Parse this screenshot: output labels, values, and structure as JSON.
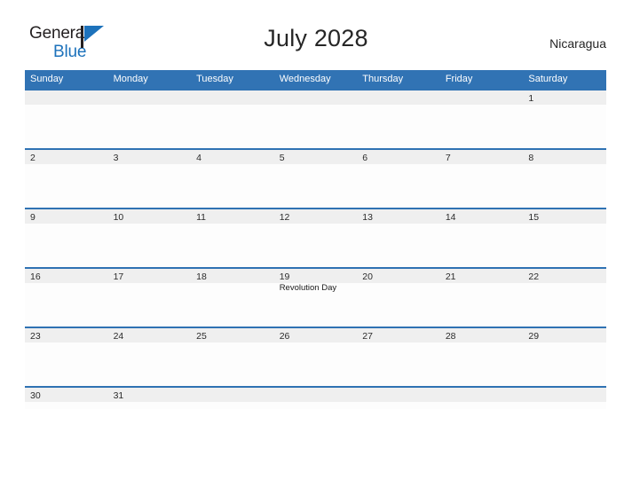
{
  "logo": {
    "word_one": "General",
    "word_two": "Blue",
    "flag_icon": "blue-flag-triangle-icon",
    "accent_color": "#1d72bb"
  },
  "header": {
    "title": "July 2028",
    "country": "Nicaragua"
  },
  "theme": {
    "header_blue": "#3173b4",
    "divider_blue": "#2f72b3",
    "daynum_band": "#efefef",
    "cell_background": "#fdfdfd",
    "text_dark": "#262626"
  },
  "calendar": {
    "weekday_headers": [
      "Sunday",
      "Monday",
      "Tuesday",
      "Wednesday",
      "Thursday",
      "Friday",
      "Saturday"
    ],
    "weeks": [
      [
        {
          "day": "",
          "events": []
        },
        {
          "day": "",
          "events": []
        },
        {
          "day": "",
          "events": []
        },
        {
          "day": "",
          "events": []
        },
        {
          "day": "",
          "events": []
        },
        {
          "day": "",
          "events": []
        },
        {
          "day": "1",
          "events": []
        }
      ],
      [
        {
          "day": "2",
          "events": []
        },
        {
          "day": "3",
          "events": []
        },
        {
          "day": "4",
          "events": []
        },
        {
          "day": "5",
          "events": []
        },
        {
          "day": "6",
          "events": []
        },
        {
          "day": "7",
          "events": []
        },
        {
          "day": "8",
          "events": []
        }
      ],
      [
        {
          "day": "9",
          "events": []
        },
        {
          "day": "10",
          "events": []
        },
        {
          "day": "11",
          "events": []
        },
        {
          "day": "12",
          "events": []
        },
        {
          "day": "13",
          "events": []
        },
        {
          "day": "14",
          "events": []
        },
        {
          "day": "15",
          "events": []
        }
      ],
      [
        {
          "day": "16",
          "events": []
        },
        {
          "day": "17",
          "events": []
        },
        {
          "day": "18",
          "events": []
        },
        {
          "day": "19",
          "events": [
            "Revolution Day"
          ]
        },
        {
          "day": "20",
          "events": []
        },
        {
          "day": "21",
          "events": []
        },
        {
          "day": "22",
          "events": []
        }
      ],
      [
        {
          "day": "23",
          "events": []
        },
        {
          "day": "24",
          "events": []
        },
        {
          "day": "25",
          "events": []
        },
        {
          "day": "26",
          "events": []
        },
        {
          "day": "27",
          "events": []
        },
        {
          "day": "28",
          "events": []
        },
        {
          "day": "29",
          "events": []
        }
      ],
      [
        {
          "day": "30",
          "events": []
        },
        {
          "day": "31",
          "events": []
        },
        {
          "day": "",
          "events": []
        },
        {
          "day": "",
          "events": []
        },
        {
          "day": "",
          "events": []
        },
        {
          "day": "",
          "events": []
        },
        {
          "day": "",
          "events": []
        }
      ]
    ]
  }
}
